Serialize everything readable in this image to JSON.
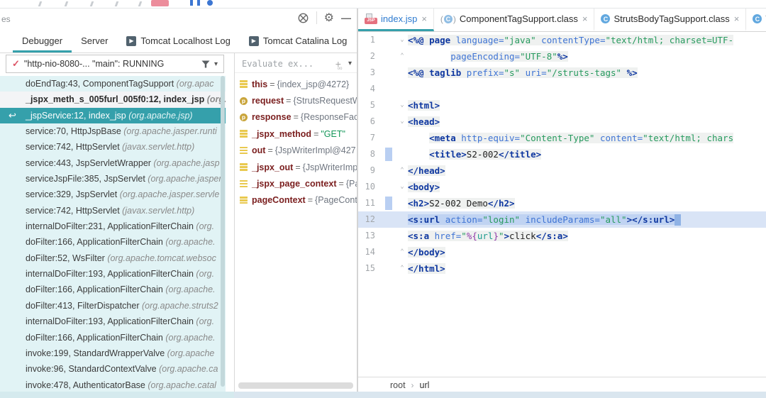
{
  "colors": {
    "accent_teal": "#35A0AB",
    "selected_frame_bg": "#35A0AB",
    "frames_list_bg": "#E1F3F5",
    "exec_line_bg": "#D9E4F6",
    "exec_chunk_bg": "#C0D3F2",
    "code_chunk_bg": "#EFF1F0",
    "vcs_change_bar": "#B9CFF2",
    "variable_name_red": "#7A1E1E",
    "string_green": "#279A5E",
    "tag_navy": "#0E37A0",
    "attribute_blue": "#3F74D4",
    "modified_file_blue": "#2E7BD0",
    "jsp_badge_pink": "#E5717F",
    "thread_check_red": "#DD5566"
  },
  "icons": {
    "gear": "⚙",
    "minimize": "—",
    "chevron_down": "▾",
    "check": "✓",
    "overflow": "»",
    "breadcrumb_sep": "›",
    "plus": "+",
    "plus_sub": "oo",
    "return_arrow": "↩",
    "close": "×",
    "fold_down": "⌄",
    "fold_up": "⌃",
    "tomcat_play": "▶",
    "class_letter": "C",
    "param_letter": "p",
    "jsp_badge": "JSP"
  },
  "debugger": {
    "panel_label_fragment": "es",
    "tabs": [
      {
        "label": "Debugger",
        "active": true,
        "icon": false
      },
      {
        "label": "Server",
        "active": false,
        "icon": false
      },
      {
        "label": "Tomcat Localhost Log",
        "active": false,
        "icon": true
      },
      {
        "label": "Tomcat Catalina Log",
        "active": false,
        "icon": true
      }
    ],
    "thread": {
      "text": "\"http-nio-8080-... \"main\": RUNNING"
    },
    "frames": [
      {
        "loc": "doEndTag:43, ComponentTagSupport",
        "pkg": "(org.apac",
        "style": "cyan"
      },
      {
        "loc": "_jspx_meth_s_005furl_005f0:12, index_jsp",
        "pkg": "(org.a",
        "style": "white"
      },
      {
        "loc": "_jspService:12, index_jsp",
        "pkg": "(org.apache.jsp)",
        "style": "selected"
      },
      {
        "loc": "service:70, HttpJspBase",
        "pkg": "(org.apache.jasper.runti",
        "style": "cyan"
      },
      {
        "loc": "service:742, HttpServlet",
        "pkg": "(javax.servlet.http)",
        "style": "cyan"
      },
      {
        "loc": "service:443, JspServletWrapper",
        "pkg": "(org.apache.jasp",
        "style": "cyan"
      },
      {
        "loc": "serviceJspFile:385, JspServlet",
        "pkg": "(org.apache.jasper.",
        "style": "cyan"
      },
      {
        "loc": "service:329, JspServlet",
        "pkg": "(org.apache.jasper.servle",
        "style": "cyan"
      },
      {
        "loc": "service:742, HttpServlet",
        "pkg": "(javax.servlet.http)",
        "style": "cyan"
      },
      {
        "loc": "internalDoFilter:231, ApplicationFilterChain",
        "pkg": "(org.",
        "style": "cyan"
      },
      {
        "loc": "doFilter:166, ApplicationFilterChain",
        "pkg": "(org.apache.",
        "style": "cyan"
      },
      {
        "loc": "doFilter:52, WsFilter",
        "pkg": "(org.apache.tomcat.websoc",
        "style": "cyan"
      },
      {
        "loc": "internalDoFilter:193, ApplicationFilterChain",
        "pkg": "(org.",
        "style": "cyan"
      },
      {
        "loc": "doFilter:166, ApplicationFilterChain",
        "pkg": "(org.apache.",
        "style": "cyan"
      },
      {
        "loc": "doFilter:413, FilterDispatcher",
        "pkg": "(org.apache.struts2",
        "style": "cyan"
      },
      {
        "loc": "internalDoFilter:193, ApplicationFilterChain",
        "pkg": "(org.",
        "style": "cyan"
      },
      {
        "loc": "doFilter:166, ApplicationFilterChain",
        "pkg": "(org.apache.",
        "style": "cyan"
      },
      {
        "loc": "invoke:199, StandardWrapperValve",
        "pkg": "(org.apache",
        "style": "cyan"
      },
      {
        "loc": "invoke:96, StandardContextValve",
        "pkg": "(org.apache.ca",
        "style": "cyan"
      },
      {
        "loc": "invoke:478, AuthenticatorBase",
        "pkg": "(org.apache.catal",
        "style": "cyan"
      }
    ]
  },
  "watches": {
    "evaluate_placeholder": "Evaluate ex...",
    "variables": [
      {
        "icon": "field",
        "name": "this",
        "value": "{index_jsp@4272}",
        "kind": "ref"
      },
      {
        "icon": "param",
        "name": "request",
        "value": "{StrutsRequestW",
        "kind": "ref"
      },
      {
        "icon": "param",
        "name": "response",
        "value": "{ResponseFaca",
        "kind": "ref"
      },
      {
        "icon": "field",
        "name": "_jspx_method",
        "value": "\"GET\"",
        "kind": "str"
      },
      {
        "icon": "field",
        "name": "out",
        "value": "{JspWriterImpl@427",
        "kind": "ref"
      },
      {
        "icon": "field",
        "name": "_jspx_out",
        "value": "{JspWriterImp",
        "kind": "ref"
      },
      {
        "icon": "field",
        "name": "_jspx_page_context",
        "value": "{Pag",
        "kind": "ref"
      },
      {
        "icon": "field",
        "name": "pageContext",
        "value": "{PageCont",
        "kind": "ref"
      }
    ]
  },
  "editor": {
    "tabs": [
      {
        "kind": "jsp",
        "label": "index.jsp",
        "active": true
      },
      {
        "kind": "class-lib",
        "label": "ComponentTagSupport.class",
        "active": false
      },
      {
        "kind": "class",
        "label": "StrutsBodyTagSupport.class",
        "active": false
      },
      {
        "kind": "class",
        "label": "Ta",
        "active": false
      }
    ],
    "lines": [
      {
        "n": "1",
        "fold": "down",
        "segs": [
          [
            "tag",
            "<%@ "
          ],
          [
            "kw",
            "page "
          ],
          [
            "attr",
            "language="
          ],
          [
            "str",
            "\"java\""
          ],
          [
            "txt",
            " "
          ],
          [
            "attr",
            "contentType="
          ],
          [
            "str",
            "\"text/html; charset=UTF-"
          ]
        ]
      },
      {
        "n": "2",
        "fold": "up",
        "segs": [
          [
            "txt",
            "        "
          ],
          [
            "attr",
            "pageEncoding="
          ],
          [
            "str",
            "\"UTF-8\""
          ],
          [
            "tag",
            "%>"
          ]
        ]
      },
      {
        "n": "3",
        "segs": [
          [
            "tag",
            "<%@ "
          ],
          [
            "kw",
            "taglib "
          ],
          [
            "attr",
            "prefix="
          ],
          [
            "str",
            "\"s\""
          ],
          [
            "txt",
            " "
          ],
          [
            "attr",
            "uri="
          ],
          [
            "str",
            "\"/struts-tags\""
          ],
          [
            "txt",
            " "
          ],
          [
            "tag",
            "%>"
          ]
        ]
      },
      {
        "n": "4",
        "segs": []
      },
      {
        "n": "5",
        "fold": "down",
        "segs": [
          [
            "tag",
            "<html>"
          ]
        ]
      },
      {
        "n": "6",
        "fold": "down",
        "segs": [
          [
            "tag",
            "<head>"
          ]
        ]
      },
      {
        "n": "7",
        "segs": [
          [
            "txt",
            "    "
          ],
          [
            "tag",
            "<meta "
          ],
          [
            "attr",
            "http-equiv="
          ],
          [
            "str",
            "\"Content-Type\""
          ],
          [
            "txt",
            " "
          ],
          [
            "attr",
            "content="
          ],
          [
            "str",
            "\"text/html; chars"
          ]
        ]
      },
      {
        "n": "8",
        "vcs": true,
        "segs": [
          [
            "txt",
            "    "
          ],
          [
            "tag",
            "<title>"
          ],
          [
            "txt",
            "S2-002"
          ],
          [
            "tag",
            "</title>"
          ]
        ]
      },
      {
        "n": "9",
        "fold": "up",
        "segs": [
          [
            "tag",
            "</head>"
          ]
        ]
      },
      {
        "n": "10",
        "fold": "down",
        "segs": [
          [
            "tag",
            "<body>"
          ]
        ]
      },
      {
        "n": "11",
        "vcs": true,
        "segs": [
          [
            "tag",
            "<h2>"
          ],
          [
            "txt",
            "S2-002 Demo"
          ],
          [
            "tag",
            "</h2>"
          ]
        ]
      },
      {
        "n": "12",
        "exec": true,
        "segs": [
          [
            "tag",
            "<s:url "
          ],
          [
            "attr",
            "action="
          ],
          [
            "str",
            "\"login\""
          ],
          [
            "txt",
            " "
          ],
          [
            "attr",
            "includeParams="
          ],
          [
            "str",
            "\"all\""
          ],
          [
            "tag",
            "></s:url>"
          ]
        ]
      },
      {
        "n": "13",
        "segs": [
          [
            "tag",
            "<s:a "
          ],
          [
            "attr",
            "href="
          ],
          [
            "str",
            "\""
          ],
          [
            "elb",
            "%{"
          ],
          [
            "elv",
            "url"
          ],
          [
            "elb",
            "}"
          ],
          [
            "str",
            "\""
          ],
          [
            "tag",
            ">"
          ],
          [
            "txt",
            "click"
          ],
          [
            "tag",
            "</s:a>"
          ]
        ]
      },
      {
        "n": "14",
        "fold": "up",
        "segs": [
          [
            "tag",
            "</body>"
          ]
        ]
      },
      {
        "n": "15",
        "fold": "up",
        "segs": [
          [
            "tag",
            "</html>"
          ]
        ]
      }
    ],
    "breadcrumb": {
      "root": "root",
      "leaf": "url"
    }
  }
}
